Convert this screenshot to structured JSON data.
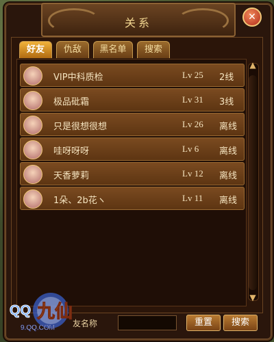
{
  "window": {
    "title": "关系",
    "close_label": "✕"
  },
  "tabs": [
    {
      "label": "好友",
      "active": true
    },
    {
      "label": "仇敌",
      "active": false
    },
    {
      "label": "黑名单",
      "active": false
    },
    {
      "label": "搜索",
      "active": false
    }
  ],
  "friends": [
    {
      "name": "VIP中科质检",
      "level": "Lv 25",
      "status": "2线"
    },
    {
      "name": "极品砒霜",
      "level": "Lv 31",
      "status": "3线"
    },
    {
      "name": "只是很想很想",
      "level": "Lv 26",
      "status": "离线"
    },
    {
      "name": "哇呀呀呀",
      "level": "Lv 6",
      "status": "离线"
    },
    {
      "name": "天香萝莉",
      "level": "Lv 12",
      "status": "离线"
    },
    {
      "name": "1朵、2b花ヽ",
      "level": "Lv 11",
      "status": "离线"
    }
  ],
  "bottom": {
    "input_label": "友名称",
    "input_value": "",
    "reset_label": "重置",
    "search_label": "搜索"
  },
  "watermark": {
    "brand": "QQ九仙",
    "url": "9.QQ.COM"
  },
  "scrollbar": {
    "up": "▲",
    "down": "▼"
  }
}
